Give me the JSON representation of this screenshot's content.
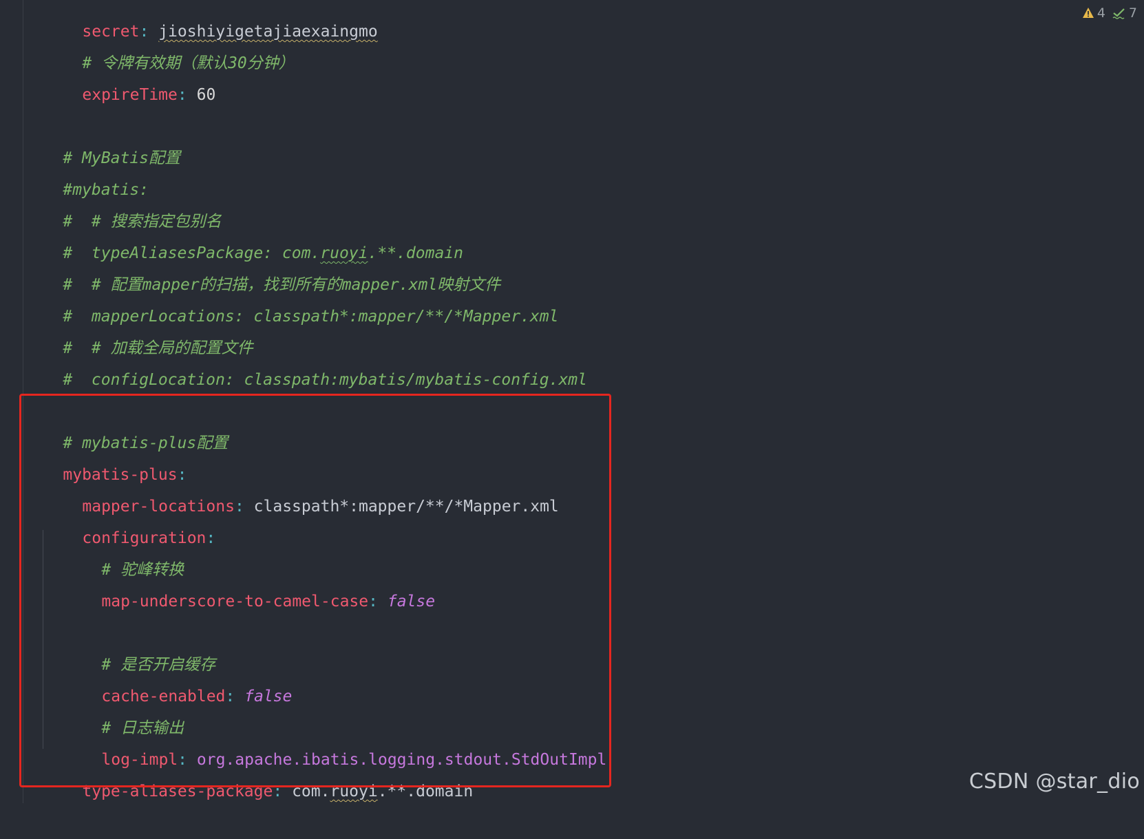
{
  "inspections": {
    "warnings": "4",
    "checks": "7"
  },
  "lines": {
    "l0_key": "secret",
    "l0_colon": ":",
    "l0_val": "jioshiyigetajiaexaingmo",
    "l1_comment": "# 令牌有效期（默认30分钟）",
    "l2_key": "expireTime",
    "l2_colon": ":",
    "l2_val": "60",
    "l3_comment": "# MyBatis配置",
    "l4_comment": "#mybatis:",
    "l5_comment": "#  # 搜索指定包别名",
    "l6_comment_a": "#  typeAliasesPackage: com.",
    "l6_comment_b": "ruoyi",
    "l6_comment_c": ".**.domain",
    "l7_comment": "#  # 配置mapper的扫描，找到所有的mapper.xml映射文件",
    "l8_comment": "#  mapperLocations: classpath*:mapper/**/*Mapper.xml",
    "l9_comment": "#  # 加载全局的配置文件",
    "l10_comment": "#  configLocation: classpath:mybatis/mybatis-config.xml",
    "l11_comment": "# mybatis-plus配置",
    "l12_key": "mybatis-plus",
    "l12_colon": ":",
    "l13_key": "mapper-locations",
    "l13_colon": ":",
    "l13_val": "classpath*:mapper/**/*Mapper.xml",
    "l14_key": "configuration",
    "l14_colon": ":",
    "l15_comment": "# 驼峰转换",
    "l16_key": "map-underscore-to-camel-case",
    "l16_colon": ":",
    "l16_val": "false",
    "l17_comment": "# 是否开启缓存",
    "l18_key": "cache-enabled",
    "l18_colon": ":",
    "l18_val": "false",
    "l19_comment": "# 日志输出",
    "l20_key": "log-impl",
    "l20_colon": ":",
    "l20_pkg": "org.apache.ibatis.logging.stdout.",
    "l20_cls": "StdOutImpl",
    "l21_key": "type-aliases-package",
    "l21_colon": ":",
    "l21_val_a": "com.",
    "l21_val_b": "ruoyi",
    "l21_val_c": ".**.domain"
  },
  "watermark": "CSDN @star_dio",
  "colors": {
    "background": "#282c34",
    "highlight_border": "#e5261f",
    "key": "#ef596f",
    "comment": "#7fb86a",
    "boolean": "#c678dd"
  }
}
